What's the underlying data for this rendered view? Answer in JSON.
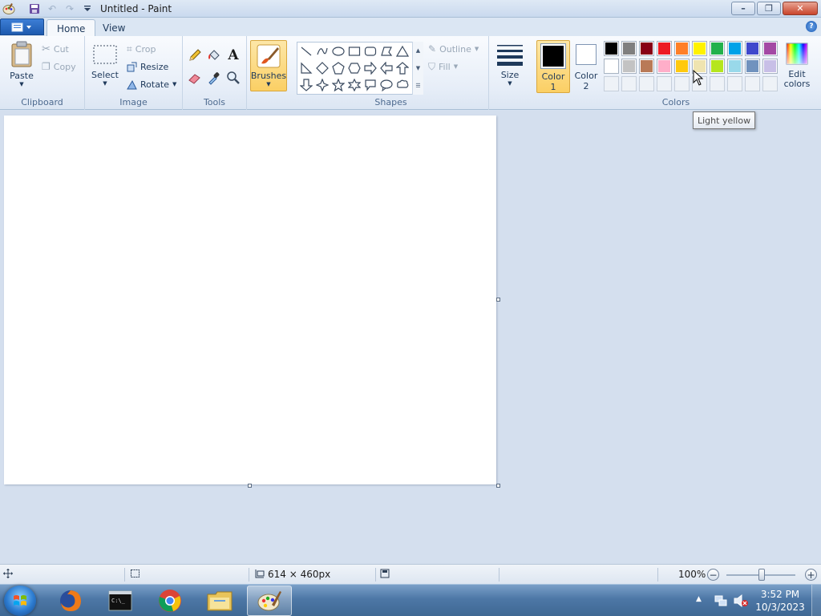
{
  "window": {
    "title": "Untitled - Paint",
    "controls": {
      "minimize": "–",
      "maximize": "❐",
      "close": "✕"
    }
  },
  "tabs": [
    {
      "label": "Home",
      "active": true
    },
    {
      "label": "View",
      "active": false
    }
  ],
  "help_label": "?",
  "ribbon": {
    "clipboard": {
      "label": "Clipboard",
      "paste": "Paste",
      "cut": "Cut",
      "copy": "Copy"
    },
    "image": {
      "label": "Image",
      "select": "Select",
      "crop": "Crop",
      "resize": "Resize",
      "rotate": "Rotate"
    },
    "tools": {
      "label": "Tools",
      "items": [
        "pencil-icon",
        "fill-icon",
        "text-icon",
        "eraser-icon",
        "color-picker-icon",
        "magnifier-icon"
      ]
    },
    "brushes": {
      "label": "Brushes"
    },
    "shapes": {
      "label": "Shapes",
      "outline": "Outline",
      "fill": "Fill"
    },
    "size": {
      "label": "Size"
    },
    "colors": {
      "label": "Colors",
      "color1": {
        "label_line1": "Color",
        "label_line2": "1",
        "value": "#000000"
      },
      "color2": {
        "label_line1": "Color",
        "label_line2": "2",
        "value": "#ffffff"
      },
      "edit_colors_line1": "Edit",
      "edit_colors_line2": "colors",
      "palette_row1": [
        "#000000",
        "#7f7f7f",
        "#880015",
        "#ed1c24",
        "#ff7f27",
        "#fff200",
        "#22b14c",
        "#00a2e8",
        "#3f48cc",
        "#a349a4"
      ],
      "palette_row2": [
        "#ffffff",
        "#c3c3c3",
        "#b97a57",
        "#ffaec9",
        "#ffc90e",
        "#efe4b0",
        "#b5e61d",
        "#99d9ea",
        "#7092be",
        "#c8bfe7"
      ]
    }
  },
  "tooltip": "Light yellow",
  "statusbar": {
    "canvas_size": "614 × 460px",
    "zoom": "100%"
  },
  "taskbar": {
    "apps": [
      "firefox-icon",
      "cmd-icon",
      "chrome-icon",
      "explorer-icon",
      "paint-icon"
    ],
    "time": "3:52 PM",
    "date": "10/3/2023"
  }
}
